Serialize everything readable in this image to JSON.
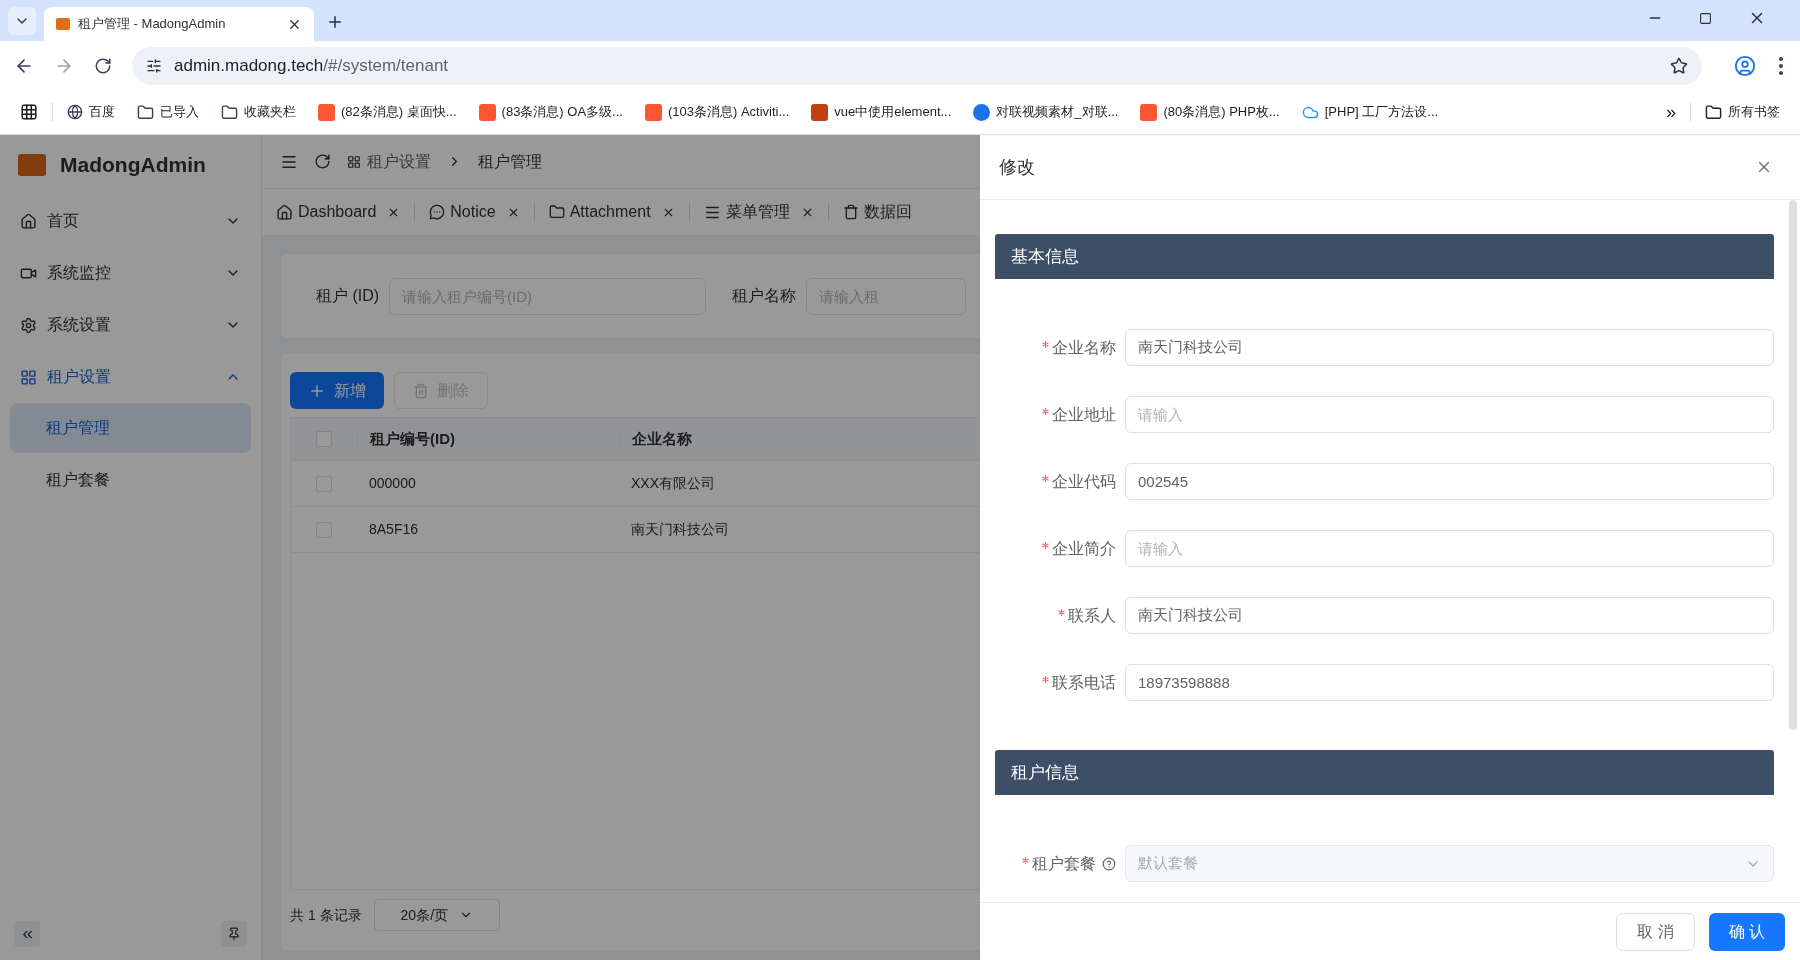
{
  "browser": {
    "tabs": [
      {
        "title": "租户管理 - MadongAdmin",
        "selected": true
      }
    ],
    "url_host": "admin.madong.tech",
    "url_path": "/#/system/tenant",
    "bookmarks": [
      {
        "label": "百度",
        "kind": "globe"
      },
      {
        "label": "已导入",
        "kind": "folder"
      },
      {
        "label": "收藏夹栏",
        "kind": "folder"
      },
      {
        "label": "(82条消息) 桌面快...",
        "kind": "c"
      },
      {
        "label": "(83条消息) OA多级...",
        "kind": "c"
      },
      {
        "label": "(103条消息) Activiti...",
        "kind": "c"
      },
      {
        "label": "vue中使用element...",
        "kind": "b"
      },
      {
        "label": "对联视频素材_对联...",
        "kind": "badge"
      },
      {
        "label": "(80条消息) PHP枚...",
        "kind": "c"
      },
      {
        "label": "[PHP] 工厂方法设...",
        "kind": "cloud"
      }
    ],
    "more": "»",
    "all_bookmarks": "所有书签"
  },
  "sidebar": {
    "logo_text": "MadongAdmin",
    "items": [
      {
        "label": "首页",
        "expanded": false,
        "selected": false
      },
      {
        "label": "系统监控",
        "expanded": false,
        "selected": false
      },
      {
        "label": "系统设置",
        "expanded": false,
        "selected": false
      },
      {
        "label": "租户设置",
        "expanded": true,
        "selected": true,
        "children": [
          {
            "label": "租户管理",
            "selected": true
          },
          {
            "label": "租户套餐",
            "selected": false
          }
        ]
      }
    ]
  },
  "header": {
    "breadcrumb": [
      "租户设置",
      "租户管理"
    ]
  },
  "tabs": [
    {
      "label": "Dashboard"
    },
    {
      "label": "Notice"
    },
    {
      "label": "Attachment"
    },
    {
      "label": "菜单管理"
    },
    {
      "label": "数据回"
    }
  ],
  "search": [
    {
      "label": "租户 (ID)",
      "placeholder": "请输入租户编号(ID)"
    },
    {
      "label": "租户名称",
      "placeholder": "请输入租"
    }
  ],
  "toolbar": [
    {
      "label": "新增",
      "kind": "primary",
      "disabled": false
    },
    {
      "label": "删除",
      "kind": "delete",
      "disabled": true
    }
  ],
  "table": {
    "all_checked": false,
    "columns": [
      "租户编号(ID)",
      "企业名称"
    ],
    "rows": [
      {
        "checked": false,
        "cells": [
          "000000",
          "XXX有限公司"
        ]
      },
      {
        "checked": false,
        "cells": [
          "8A5F16",
          "南天门科技公司"
        ]
      }
    ]
  },
  "pagination": {
    "total": "共 1 条记录",
    "page_size": "20条/页"
  },
  "drawer": {
    "title": "修改",
    "sections": [
      {
        "title": "基本信息",
        "fields": [
          {
            "label": "企业名称",
            "required": true,
            "kind": "input",
            "value": "南天门科技公司"
          },
          {
            "label": "企业地址",
            "required": true,
            "kind": "input",
            "placeholder": "请输入"
          },
          {
            "label": "企业代码",
            "required": true,
            "kind": "input",
            "value": "002545"
          },
          {
            "label": "企业简介",
            "required": true,
            "kind": "input",
            "placeholder": "请输入"
          },
          {
            "label": "联系人",
            "required": true,
            "kind": "input",
            "value": "南天门科技公司"
          },
          {
            "label": "联系电话",
            "required": true,
            "kind": "input",
            "value": "18973598888"
          }
        ]
      },
      {
        "title": "租户信息",
        "fields": [
          {
            "label": "租户套餐",
            "required": true,
            "kind": "select",
            "help": true,
            "disabled": true,
            "value": "默认套餐"
          }
        ]
      }
    ],
    "buttons": [
      {
        "label": "取 消",
        "kind": "default"
      },
      {
        "label": "确 认",
        "kind": "primary"
      }
    ]
  }
}
